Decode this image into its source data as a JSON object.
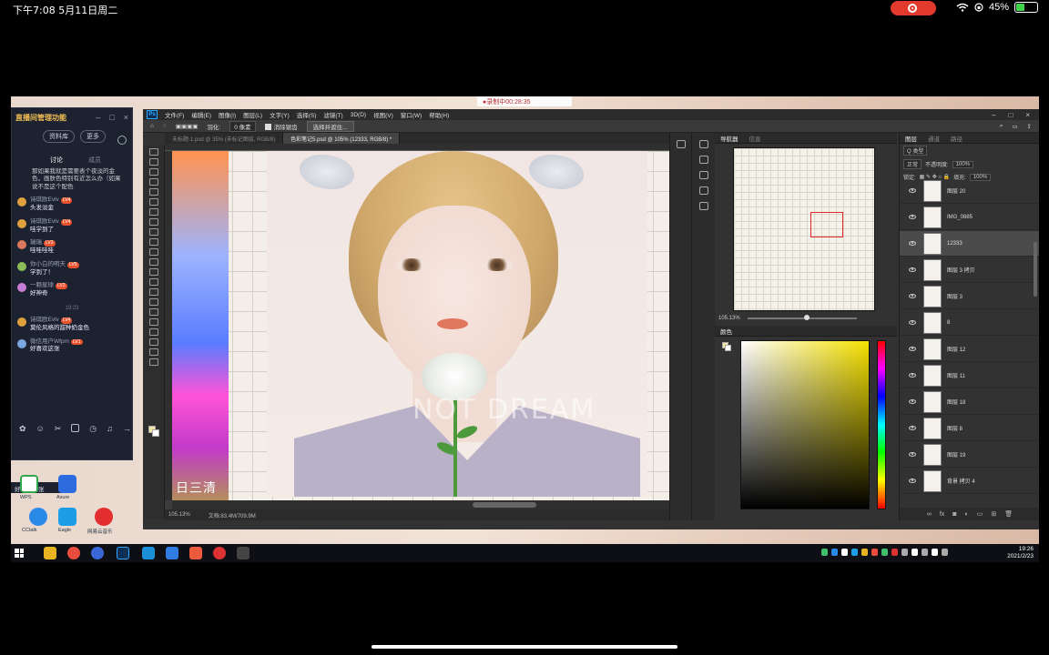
{
  "ios": {
    "time": "下午7:08   5月11日周二",
    "battery": "45%",
    "battery_level": 0.45
  },
  "recording_pill": "●录制中00:28:35",
  "chat": {
    "title": "直播间管理功能",
    "btn_profile": "资料库",
    "btn_more": "更多",
    "tab_discuss": "讨论",
    "tab_members": "成员",
    "notice": "那如果我就是需要表个夜淡的金色，画肤色特别有近怎么办（如果说不是这个配色",
    "messages": [
      {
        "name": "诗琪欧Evlv",
        "badge": "LV4",
        "text": "头发淡金",
        "color": "#e0a040"
      },
      {
        "name": "诗琪欧Evlv",
        "badge": "LV4",
        "text": "哇学到了",
        "color": "#e0a040"
      },
      {
        "name": "瑞瑞",
        "badge": "LV3",
        "text": "哇哇哇哇",
        "color": "#d87a5a"
      },
      {
        "name": "你小白的明天",
        "badge": "LV5",
        "text": "学到了！",
        "color": "#8bbd5a"
      },
      {
        "name": "一颗星球",
        "badge": "LV2",
        "text": "好神奇",
        "color": "#c77dd3"
      }
    ],
    "separator": "19:23",
    "messages2": [
      {
        "name": "诗琪欧Evlv",
        "badge": "LV4",
        "text": "莫伦风格的甜种奶金色",
        "color": "#e0a040"
      },
      {
        "name": "微信用户Wfpm",
        "badge": "LV1",
        "text": "好喜欢这张",
        "color": "#7aa7e0"
      }
    ],
    "typing": "好喜欢这张"
  },
  "desktop_icons": [
    {
      "label": "WPS"
    },
    {
      "label": "Axure"
    },
    {
      "label": "CCtalk"
    },
    {
      "label": "Eagle"
    },
    {
      "label": "网易云音乐"
    }
  ],
  "ps": {
    "logo": "Ps",
    "menus": [
      "文件(F)",
      "编辑(E)",
      "图像(I)",
      "图层(L)",
      "文字(Y)",
      "选择(S)",
      "滤镜(T)",
      "3D(D)",
      "视图(V)",
      "窗口(W)",
      "帮助(H)"
    ],
    "options": {
      "feather_label": "羽化:",
      "feather_value": "0 像素",
      "antialias": "消除锯齿",
      "select_mask": "选择并遮住..."
    },
    "tabs": [
      "未标题-1.psd @ 35% (未标记图层, RGB/8)",
      "色彩笔记5.psd @ 105% (12333, RGB/8) *"
    ],
    "collage_text": "日三清",
    "watermark": "NOT DREAM",
    "status_zoom": "105.13%",
    "status_doc": "文档:83.4M/709.9M",
    "nav_tabs": [
      "导航器",
      "信息"
    ],
    "nav_zoom": "105.13%",
    "color_tab": "颜色",
    "layers_tabs": [
      "图层",
      "通道",
      "路径"
    ],
    "layer_kind": "Q 类型",
    "blend_mode": "正常",
    "opacity_label": "不透明度:",
    "opacity": "100%",
    "lock_label": "锁定:",
    "fill_label": "填充:",
    "fill": "100%",
    "layers": [
      "图层 20",
      "IMG_0885",
      "12333",
      "图层 3 拷贝",
      "图层 3",
      "8",
      "图层 12",
      "图层 11",
      "图层 18",
      "图层 8",
      "图层 19",
      "背景 拷贝 4"
    ],
    "selected_layer": "12333"
  },
  "taskbar": {
    "time": "19:26",
    "date": "2021/2/23"
  }
}
